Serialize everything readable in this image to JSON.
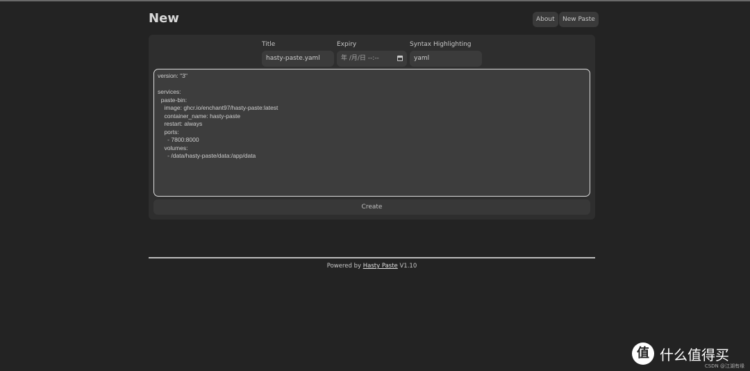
{
  "header": {
    "title": "New",
    "about": "About",
    "new_paste": "New Paste"
  },
  "form": {
    "title_label": "Title",
    "title_value": "hasty-paste.yaml",
    "expiry_label": "Expiry",
    "expiry_value": "年 /月/日 --:--",
    "syntax_label": "Syntax Highlighting",
    "syntax_value": "yaml",
    "content": "version: \"3\"\n\nservices:\n  paste-bin:\n    image: ghcr.io/enchant97/hasty-paste:latest\n    container_name: hasty-paste\n    restart: always\n    ports:\n      - 7800:8000\n    volumes:\n      - /data/hasty-paste/data:/app/data",
    "create": "Create"
  },
  "footer": {
    "prefix": "Powered by",
    "link": "Hasty Paste",
    "version": "V1.10"
  },
  "watermark": {
    "logo": "值",
    "text": "什么值得买",
    "credit": "CSDN @江湖有缘"
  }
}
